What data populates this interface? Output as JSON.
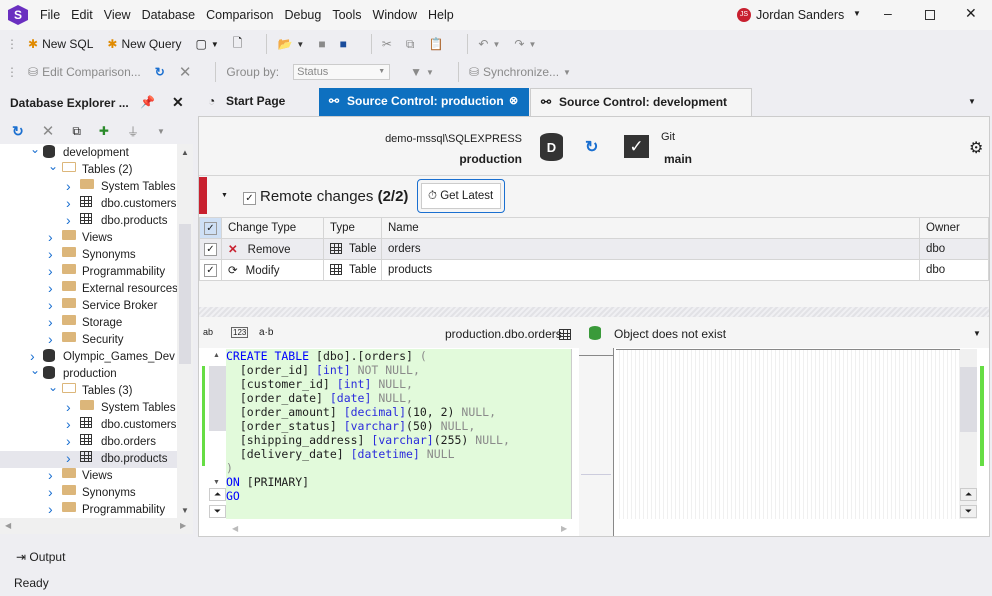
{
  "app": {
    "logo_letter": "S",
    "user_initials": "JS",
    "user_name": "Jordan  Sanders",
    "brand_color": "#6a2fc0",
    "avatar_color": "#c8202f"
  },
  "menu": [
    "File",
    "Edit",
    "View",
    "Database",
    "Comparison",
    "Debug",
    "Tools",
    "Window",
    "Help"
  ],
  "toolbar1": {
    "new_sql": "New SQL",
    "new_query": "New Query"
  },
  "toolbar2": {
    "edit_comparison": "Edit Comparison...",
    "group_by_label": "Group by:",
    "group_by_value": "Status",
    "synchronize": "Synchronize..."
  },
  "explorer": {
    "title": "Database Explorer ...",
    "items": [
      {
        "label": "development",
        "level": 0,
        "icon": "database",
        "expanded": true
      },
      {
        "label": "Tables (2)",
        "level": 1,
        "icon": "folder-open",
        "expanded": true
      },
      {
        "label": "System Tables",
        "level": 2,
        "icon": "folder"
      },
      {
        "label": "dbo.customers",
        "level": 2,
        "icon": "table"
      },
      {
        "label": "dbo.products",
        "level": 2,
        "icon": "table"
      },
      {
        "label": "Views",
        "level": 1,
        "icon": "folder"
      },
      {
        "label": "Synonyms",
        "level": 1,
        "icon": "folder"
      },
      {
        "label": "Programmability",
        "level": 1,
        "icon": "folder"
      },
      {
        "label": "External resources",
        "level": 1,
        "icon": "folder"
      },
      {
        "label": "Service Broker",
        "level": 1,
        "icon": "folder"
      },
      {
        "label": "Storage",
        "level": 1,
        "icon": "folder"
      },
      {
        "label": "Security",
        "level": 1,
        "icon": "folder"
      },
      {
        "label": "Olympic_Games_Dev",
        "level": 0,
        "icon": "database"
      },
      {
        "label": "production",
        "level": 0,
        "icon": "database",
        "expanded": true
      },
      {
        "label": "Tables (3)",
        "level": 1,
        "icon": "folder-open",
        "expanded": true
      },
      {
        "label": "System Tables",
        "level": 2,
        "icon": "folder"
      },
      {
        "label": "dbo.customers",
        "level": 2,
        "icon": "table"
      },
      {
        "label": "dbo.orders",
        "level": 2,
        "icon": "table"
      },
      {
        "label": "dbo.products",
        "level": 2,
        "icon": "table",
        "selected": true
      },
      {
        "label": "Views",
        "level": 1,
        "icon": "folder"
      },
      {
        "label": "Synonyms",
        "level": 1,
        "icon": "folder"
      },
      {
        "label": "Programmability",
        "level": 1,
        "icon": "folder"
      }
    ]
  },
  "tabs": [
    {
      "label": "Start Page"
    },
    {
      "label": "Source Control: production",
      "active": true
    },
    {
      "label": "Source Control: development"
    }
  ],
  "source": {
    "server": "demo-mssql\\SQLEXPRESS",
    "database": "production",
    "db_letter": "D",
    "vcs": "Git",
    "branch": "main"
  },
  "changes": {
    "title": "Remote changes",
    "count": "(2/2)",
    "get_latest": "Get Latest",
    "columns": [
      "Change Type",
      "Type",
      "Name",
      "Owner"
    ],
    "rows": [
      {
        "change": "Remove",
        "type": "Table",
        "name": "orders",
        "owner": "dbo"
      },
      {
        "change": "Modify",
        "type": "Table",
        "name": "products",
        "owner": "dbo"
      }
    ]
  },
  "diff": {
    "object": "production.dbo.orders",
    "status": "Object does not exist",
    "tool_wrap": "ab",
    "tool_num": "123",
    "tool_ws": "a·b",
    "code": [
      [
        [
          "CREATE TABLE ",
          "kw"
        ],
        [
          "[dbo].[orders] ",
          ""
        ],
        [
          "(",
          "nu"
        ]
      ],
      [
        [
          "  [order_id] ",
          ""
        ],
        [
          "[int] ",
          "ty"
        ],
        [
          "NOT NULL,",
          "nu"
        ]
      ],
      [
        [
          "  [customer_id] ",
          ""
        ],
        [
          "[int] ",
          "ty"
        ],
        [
          "NULL,",
          "nu"
        ]
      ],
      [
        [
          "  [order_date] ",
          ""
        ],
        [
          "[date] ",
          "ty"
        ],
        [
          "NULL,",
          "nu"
        ]
      ],
      [
        [
          "  [order_amount] ",
          ""
        ],
        [
          "[decimal]",
          "ty"
        ],
        [
          "(10, 2) ",
          ""
        ],
        [
          "NULL,",
          "nu"
        ]
      ],
      [
        [
          "  [order_status] ",
          ""
        ],
        [
          "[varchar]",
          "ty"
        ],
        [
          "(50) ",
          ""
        ],
        [
          "NULL,",
          "nu"
        ]
      ],
      [
        [
          "  [shipping_address] ",
          ""
        ],
        [
          "[varchar]",
          "ty"
        ],
        [
          "(255) ",
          ""
        ],
        [
          "NULL,",
          "nu"
        ]
      ],
      [
        [
          "  [delivery_date] ",
          ""
        ],
        [
          "[datetime] ",
          "ty"
        ],
        [
          "NULL",
          "nu"
        ]
      ],
      [
        [
          ")",
          "nu"
        ]
      ],
      [
        [
          "ON ",
          "kw"
        ],
        [
          "[PRIMARY]",
          ""
        ]
      ],
      [
        [
          "GO",
          "kw"
        ]
      ]
    ]
  },
  "output": {
    "label": "Output"
  },
  "status": {
    "text": "Ready"
  }
}
